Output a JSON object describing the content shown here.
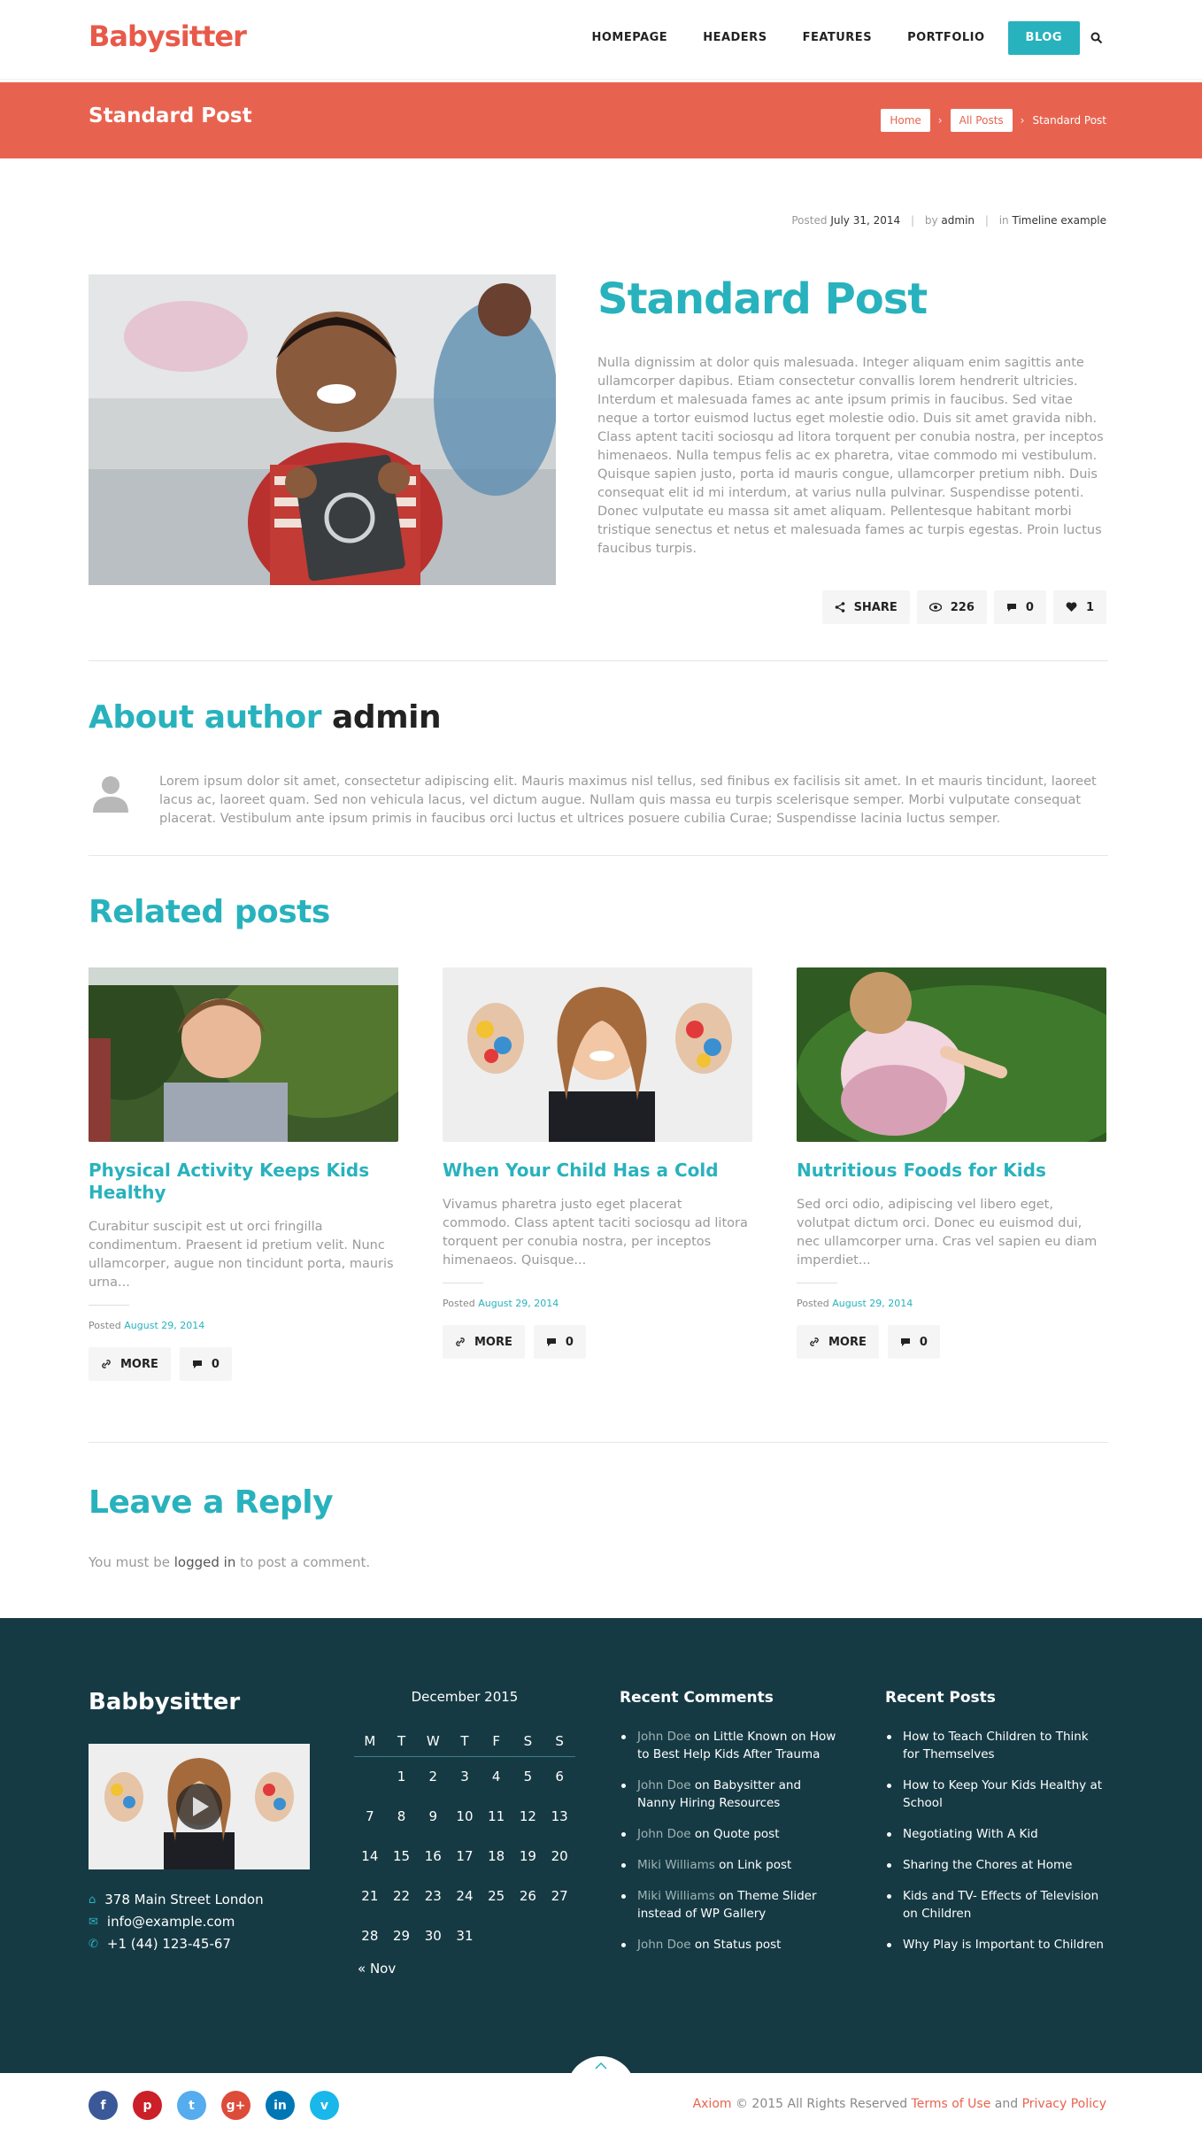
{
  "header": {
    "logo": "Babysitter",
    "nav": [
      "HOMEPAGE",
      "HEADERS",
      "FEATURES",
      "PORTFOLIO",
      "BLOG"
    ]
  },
  "banner": {
    "title": "Standard Post",
    "breadcrumbs": [
      "Home",
      "All Posts",
      "Standard Post"
    ]
  },
  "meta": {
    "posted_label": "Posted",
    "date": "July 31, 2014",
    "by_label": "by",
    "author": "admin",
    "in_label": "in",
    "category": "Timeline example"
  },
  "post": {
    "title": "Standard Post",
    "body": "Nulla dignissim at dolor quis malesuada. Integer aliquam enim sagittis ante ullamcorper dapibus. Etiam consectetur convallis lorem hendrerit ultricies. Interdum et malesuada fames ac ante ipsum primis in faucibus. Sed vitae neque a tortor euismod luctus eget molestie odio. Duis sit amet gravida nibh. Class aptent taciti sociosqu ad litora torquent per conubia nostra, per inceptos himenaeos. Nulla tempus felis ac ex pharetra, vitae commodo mi vestibulum. Quisque sapien justo, porta id mauris congue, ullamcorper pretium nibh. Duis consequat elit id mi interdum, at varius nulla pulvinar. Suspendisse potenti. Donec vulputate eu massa sit amet aliquam. Pellentesque habitant morbi tristique senectus et netus et malesuada fames ac turpis egestas. Proin luctus faucibus turpis.",
    "share_label": "SHARE",
    "views": "226",
    "comments": "0",
    "likes": "1"
  },
  "about": {
    "title": "About author",
    "name": "admin",
    "bio": "Lorem ipsum dolor sit amet, consectetur adipiscing elit. Mauris maximus nisl tellus, sed finibus ex facilisis sit amet. In et mauris tincidunt, laoreet lacus ac, laoreet quam. Sed non vehicula lacus, vel dictum augue. Nullam quis massa eu turpis scelerisque semper. Morbi vulputate consequat placerat. Vestibulum ante ipsum primis in faucibus orci luctus et ultrices posuere cubilia Curae; Suspendisse lacinia luctus semper."
  },
  "related": {
    "title": "Related posts",
    "posted_label": "Posted",
    "more_label": "MORE",
    "items": [
      {
        "title": "Physical Activity Keeps Kids Healthy",
        "excerpt": "Curabitur suscipit est ut orci fringilla condimentum. Praesent id pretium velit. Nunc ullamcorper, augue non tincidunt porta, mauris urna...",
        "date": "August 29, 2014",
        "comments": "0"
      },
      {
        "title": "When Your Child Has a Cold",
        "excerpt": "Vivamus pharetra justo eget placerat commodo. Class aptent taciti sociosqu ad litora torquent per conubia nostra, per inceptos himenaeos. Quisque...",
        "date": "August 29, 2014",
        "comments": "0"
      },
      {
        "title": "Nutritious Foods for Kids",
        "excerpt": "Sed orci odio, adipiscing vel libero eget, volutpat dictum orci. Donec eu euismod dui, nec ullamcorper urna. Cras vel sapien eu diam imperdiet...",
        "date": "August 29, 2014",
        "comments": "0"
      }
    ]
  },
  "reply": {
    "title": "Leave a Reply",
    "pre": "You must be",
    "link": "logged in",
    "post": "to post a comment."
  },
  "footer": {
    "logo": "Babbysitter",
    "address": "378 Main Street London",
    "email": "info@example.com",
    "phone": "+1 (44) 123-45-67",
    "calendar": {
      "caption": "December 2015",
      "days": [
        "M",
        "T",
        "W",
        "T",
        "F",
        "S",
        "S"
      ],
      "weeks": [
        [
          "",
          "1",
          "2",
          "3",
          "4",
          "5",
          "6"
        ],
        [
          "7",
          "8",
          "9",
          "10",
          "11",
          "12",
          "13"
        ],
        [
          "14",
          "15",
          "16",
          "17",
          "18",
          "19",
          "20"
        ],
        [
          "21",
          "22",
          "23",
          "24",
          "25",
          "26",
          "27"
        ],
        [
          "28",
          "29",
          "30",
          "31",
          "",
          "",
          ""
        ]
      ],
      "prev": "« Nov"
    },
    "recent_comments": {
      "title": "Recent Comments",
      "items": [
        {
          "who": "John Doe",
          "on": "on",
          "what": "Little Known on How to Best Help Kids After Trauma"
        },
        {
          "who": "John Doe",
          "on": "on",
          "what": "Babysitter and Nanny Hiring Resources"
        },
        {
          "who": "John Doe",
          "on": "on",
          "what": "Quote post"
        },
        {
          "who": "Miki Williams",
          "on": "on",
          "what": "Link post"
        },
        {
          "who": "Miki Williams",
          "on": "on",
          "what": "Theme Slider instead of WP Gallery"
        },
        {
          "who": "John Doe",
          "on": "on",
          "what": "Status post"
        }
      ]
    },
    "recent_posts": {
      "title": "Recent Posts",
      "items": [
        "How to Teach Children to Think for Themselves",
        "How to Keep Your Kids Healthy at School",
        "Negotiating With A Kid",
        "Sharing the Chores at Home",
        "Kids and TV- Effects of Television on Children",
        "Why Play is Important to Children"
      ]
    },
    "copyright": {
      "brand": "Axiom",
      "text": "© 2015 All Rights Reserved",
      "terms": "Terms of Use",
      "and": "and",
      "privacy": "Privacy Policy"
    },
    "socials": [
      "f",
      "p",
      "t",
      "g+",
      "in",
      "v"
    ]
  },
  "colors": {
    "accent": "#28b2bd",
    "brand": "#e8634f",
    "footer": "#163a44"
  }
}
